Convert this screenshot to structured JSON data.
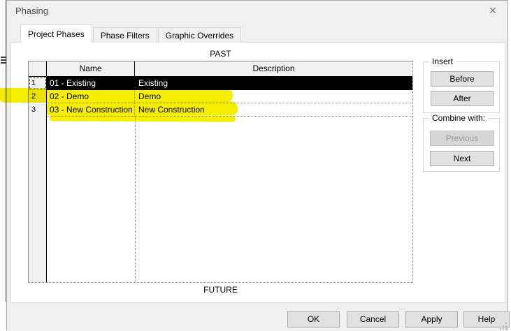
{
  "window": {
    "title": "Phasing",
    "close_icon": "✕"
  },
  "tabs": [
    {
      "label": "Project Phases",
      "active": true
    },
    {
      "label": "Phase Filters",
      "active": false
    },
    {
      "label": "Graphic Overrides",
      "active": false
    }
  ],
  "phase_table": {
    "past_label": "PAST",
    "future_label": "FUTURE",
    "columns": {
      "name": "Name",
      "description": "Description"
    },
    "rows": [
      {
        "num": "1",
        "name": "01 - Existing",
        "description": "Existing",
        "selected": true,
        "highlighted": false
      },
      {
        "num": "2",
        "name": "02 - Demo",
        "description": "Demo",
        "selected": false,
        "highlighted": true
      },
      {
        "num": "3",
        "name": "03 - New Construction",
        "description": "New Construction",
        "selected": false,
        "highlighted": true
      }
    ]
  },
  "insert_group": {
    "label": "Insert",
    "before_button": "Before",
    "after_button": "After"
  },
  "combine_group": {
    "label": "Combine with:",
    "previous_button": "Previous",
    "previous_enabled": false,
    "next_button": "Next"
  },
  "footer": {
    "ok_button": "OK",
    "cancel_button": "Cancel",
    "apply_button": "Apply",
    "help_button": "Help"
  },
  "annotation": {
    "highlight_color": "#f6ee00",
    "highlighted_rows": [
      "2",
      "3"
    ]
  },
  "colors": {
    "dialog_bg": "#f0f0f0",
    "pane_bg": "#ffffff",
    "selection_bg": "#000000",
    "selection_text": "#ffffff"
  }
}
